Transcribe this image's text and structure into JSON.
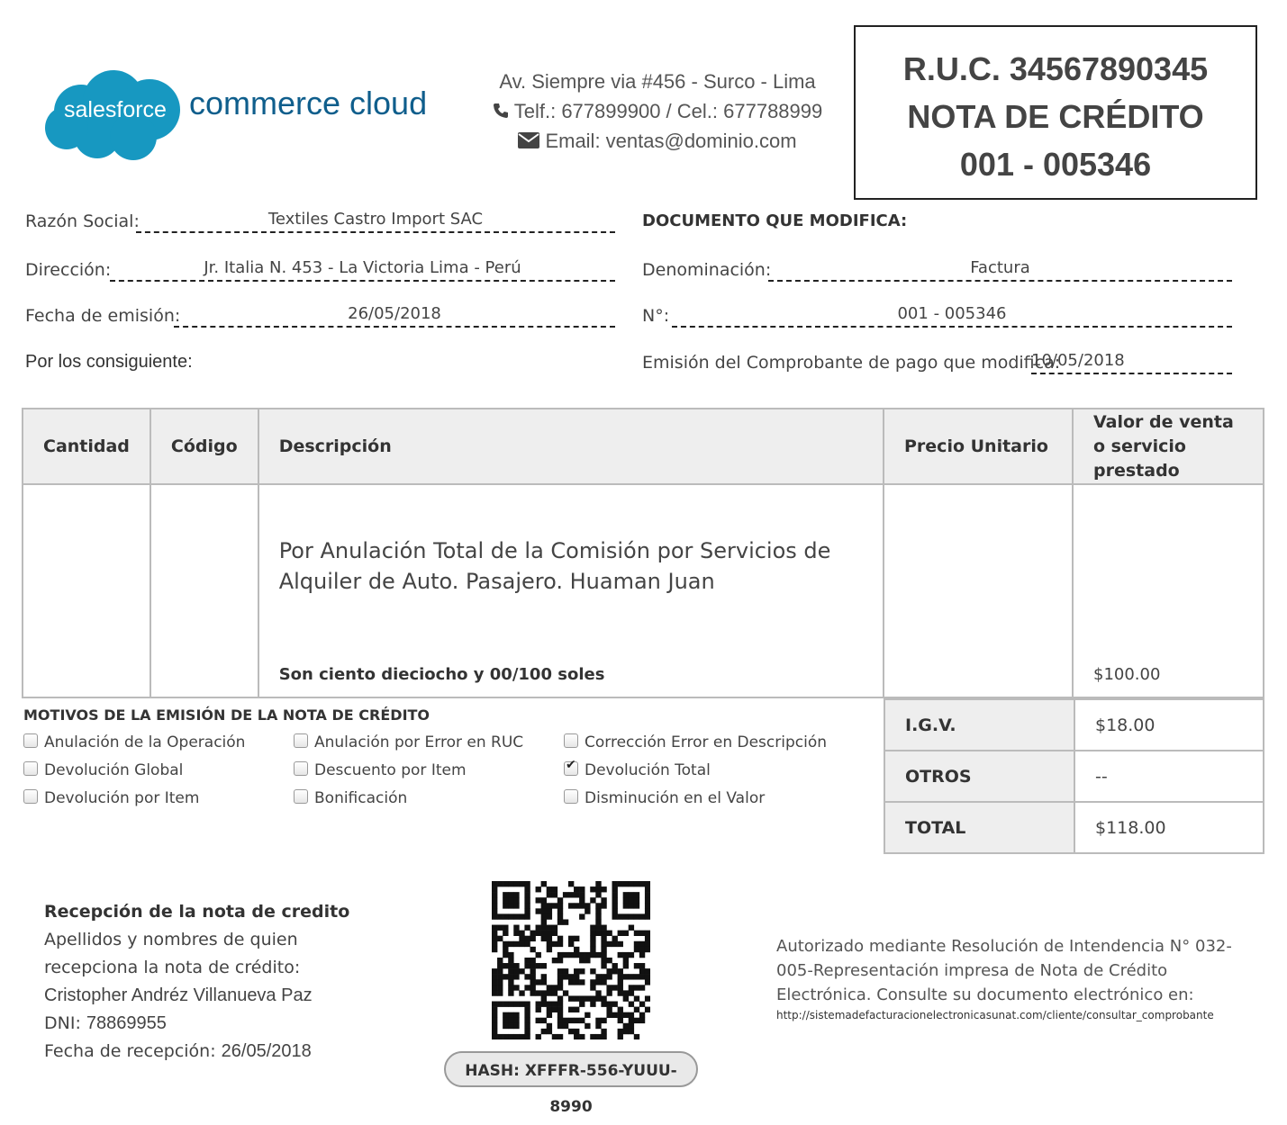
{
  "header": {
    "logo_badge": "salesforce",
    "logo_text": "commerce cloud",
    "address": "Av. Siempre via #456 - Surco - Lima",
    "phone": "Telf.: 677899900 / Cel.: 677788999",
    "email": "Email: ventas@dominio.com",
    "phone_icon": "phone-icon",
    "email_icon": "envelope-icon",
    "brand_color": "#1798c1"
  },
  "document_box": {
    "ruc": "R.U.C. 34567890345",
    "type": "NOTA DE CRÉDITO",
    "number": "001 - 005346"
  },
  "client": {
    "razon_label": "Razón Social:",
    "razon_value": "Textiles Castro Import SAC",
    "direccion_label": "Dirección:",
    "direccion_value": "Jr. Italia N. 453 - La Victoria Lima - Perú",
    "fecha_label": "Fecha de emisión:",
    "fecha_value": "26/05/2018",
    "consiguiente": "Por los consiguiente:"
  },
  "modifies": {
    "title": "DOCUMENTO QUE MODIFICA:",
    "denominacion_label": "Denominación:",
    "denominacion_value": "Factura",
    "numero_label": "N°:",
    "numero_value": "001 - 005346",
    "emision_label": "Emisión del Comprobante de pago que modifica:",
    "emision_value": "10/05/2018"
  },
  "table": {
    "headers": [
      "Cantidad",
      "Código",
      "Descripción",
      "Precio Unitario",
      "Valor de venta o servicio prestado"
    ],
    "description": "Por Anulación Total de la Comisión por Servicios de Alquiler de Auto. Pasajero. Huaman Juan",
    "amount_words": "Son ciento dieciocho y 00/100 soles",
    "line_value": "$100.00"
  },
  "totals": [
    {
      "label": "I.G.V.",
      "value": "$18.00"
    },
    {
      "label": "OTROS",
      "value": "--"
    },
    {
      "label": "TOTAL",
      "value": "$118.00"
    }
  ],
  "motivos": {
    "title": "MOTIVOS DE LA EMISIÓN DE LA NOTA DE CRÉDITO",
    "options": [
      {
        "label": "Anulación de la Operación",
        "checked": false
      },
      {
        "label": "Anulación por Error en RUC",
        "checked": false
      },
      {
        "label": "Corrección Error en Descripción",
        "checked": false
      },
      {
        "label": "Devolución Global",
        "checked": false
      },
      {
        "label": "Descuento por Item",
        "checked": false
      },
      {
        "label": "Devolución Total",
        "checked": true
      },
      {
        "label": "Devolución por Item",
        "checked": false
      },
      {
        "label": "Bonificación",
        "checked": false
      },
      {
        "label": "Disminución en el Valor",
        "checked": false
      }
    ]
  },
  "reception": {
    "title": "Recepción de la nota de credito",
    "line1": "Apellidos y nombres de quien",
    "line2": "recepciona la nota de crédito:",
    "name": "Cristopher Andréz Villanueva Paz",
    "dni_label": "DNI:",
    "dni_value": "78869955",
    "fecha_label": "Fecha de recepción:",
    "fecha_value": "26/05/2018"
  },
  "qr_icon": "qr-code",
  "hash": "HASH: XFFFR-556-YUUU-8990",
  "authorization": {
    "text": "Autorizado mediante Resolución de Intendencia N° 032-005-Representación impresa de Nota de Crédito Electrónica. Consulte su documento electrónico en:",
    "url": "http://sistemadefacturacionelectronicasunat.com/cliente/consultar_comprobante"
  }
}
